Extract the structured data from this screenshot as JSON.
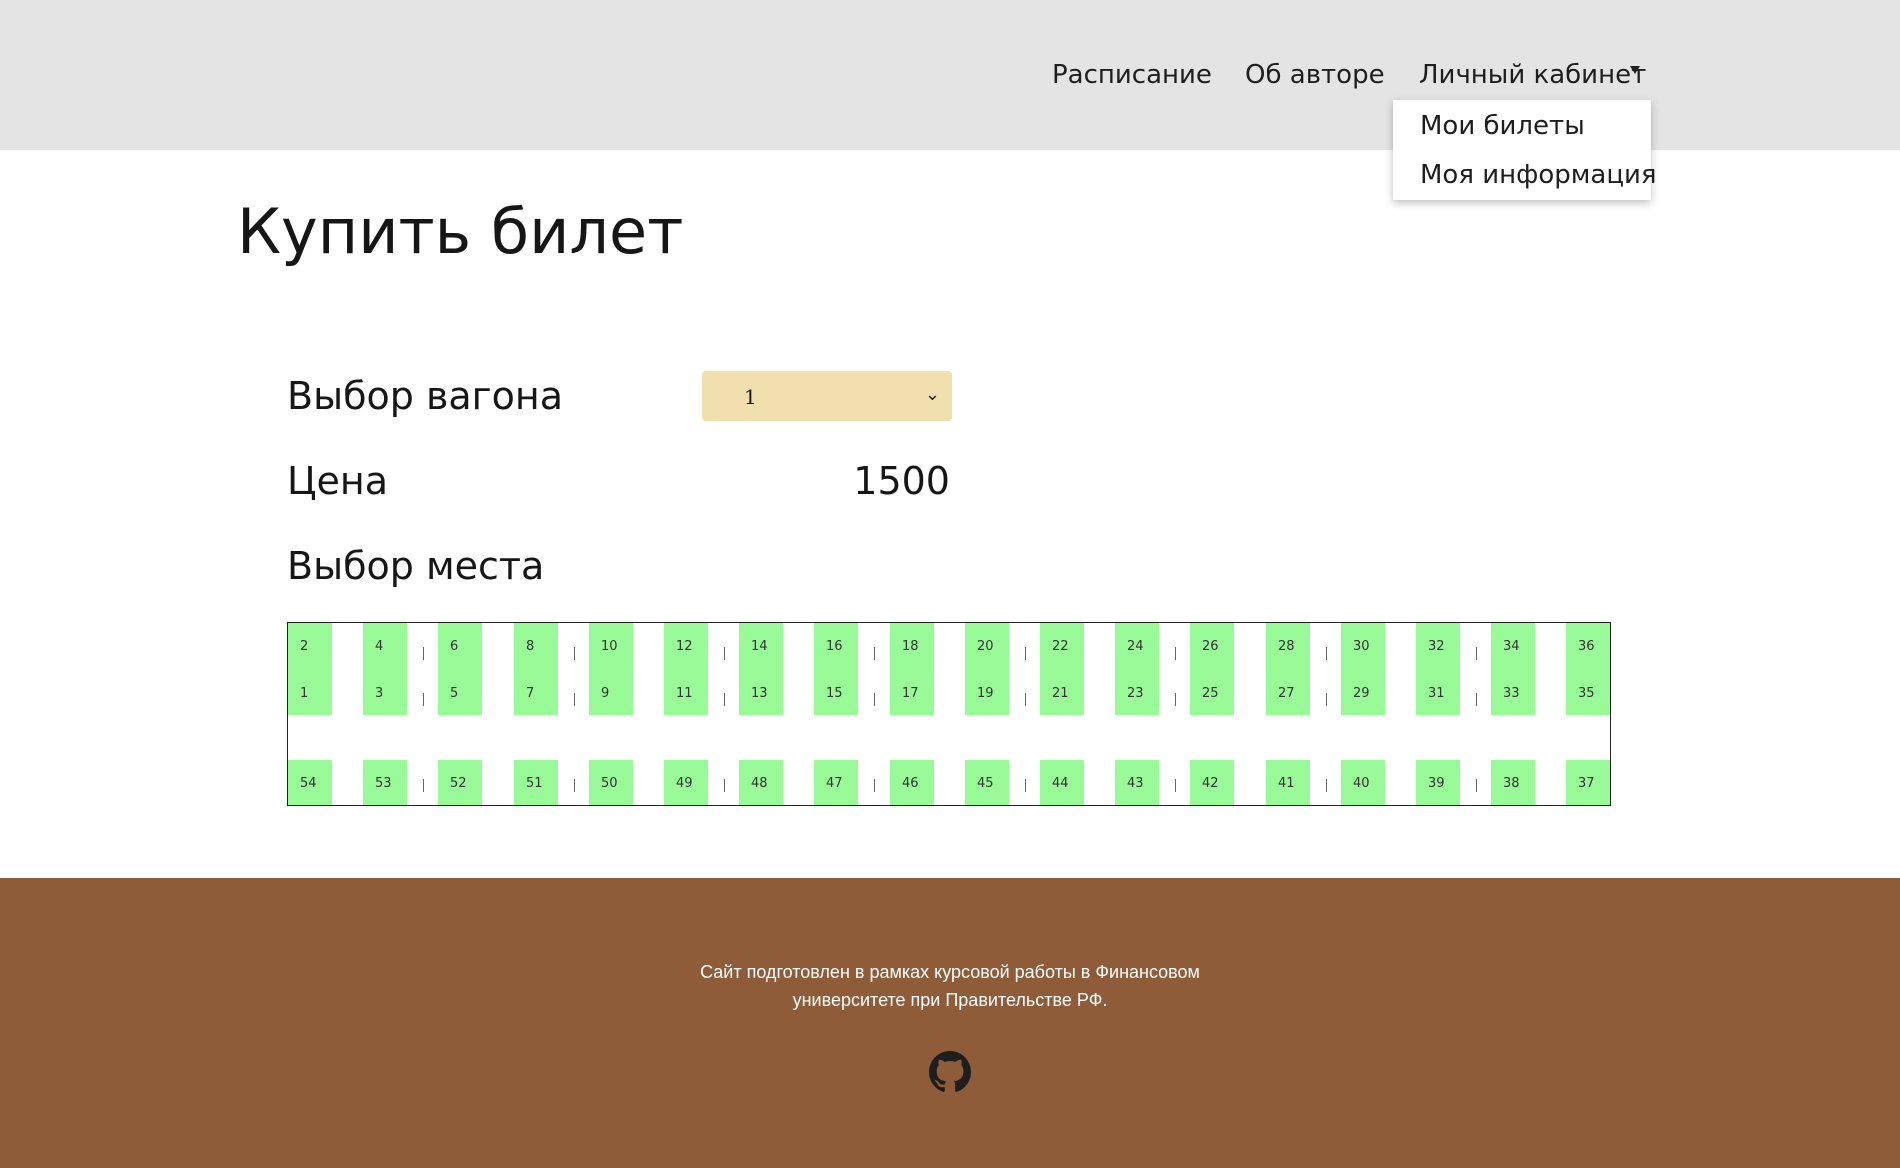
{
  "nav": {
    "items": [
      {
        "label": "Расписание"
      },
      {
        "label": "Об авторе"
      },
      {
        "label": "Личный кабинет"
      }
    ],
    "dropdown": [
      {
        "label": "Мои билеты"
      },
      {
        "label": "Моя информация"
      }
    ]
  },
  "main": {
    "title": "Купить билет",
    "wagon_label": "Выбор вагона",
    "wagon_value": "1",
    "price_label": "Цена",
    "price_value": "1500",
    "seat_label": "Выбор места"
  },
  "seats": {
    "top_upper": [
      "2",
      "4",
      "6",
      "8",
      "10",
      "12",
      "14",
      "16",
      "18",
      "20",
      "22",
      "24",
      "26",
      "28",
      "30",
      "32",
      "34",
      "36"
    ],
    "top_lower": [
      "1",
      "3",
      "5",
      "7",
      "9",
      "11",
      "13",
      "15",
      "17",
      "19",
      "21",
      "23",
      "25",
      "27",
      "29",
      "31",
      "33",
      "35"
    ],
    "side": [
      "54",
      "53",
      "52",
      "51",
      "50",
      "49",
      "48",
      "47",
      "46",
      "45",
      "44",
      "43",
      "42",
      "41",
      "40",
      "39",
      "38",
      "37"
    ],
    "seat_color": "#98fb98"
  },
  "footer": {
    "text_line1": "Сайт подготовлен в рамках курсовой работы в Финансовом",
    "text_line2": "университете при Правительстве РФ.",
    "icon": "github-icon"
  },
  "colors": {
    "header_bg": "#e4e4e4",
    "footer_bg": "#8e5c38",
    "select_bg": "#f1dfad",
    "seat_free": "#98fb98"
  }
}
